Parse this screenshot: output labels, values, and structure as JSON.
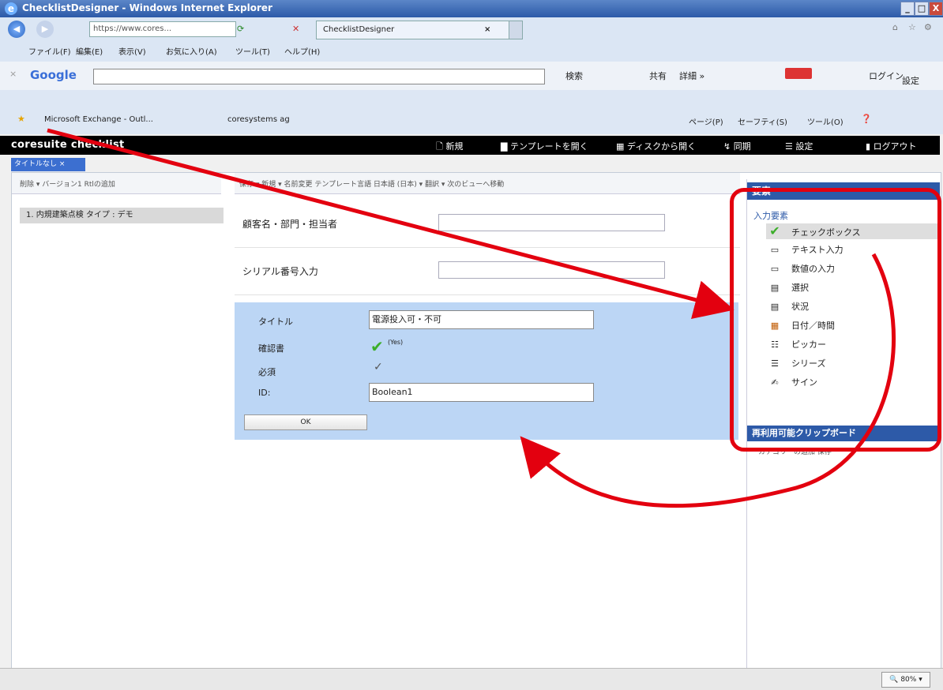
{
  "window": {
    "title": "ChecklistDesigner - Windows Internet Explorer",
    "min": "_",
    "max": "□",
    "close": "X"
  },
  "browser": {
    "url": "https://www.cores...",
    "tab_title": "ChecklistDesigner",
    "tab_close": "×",
    "menu": [
      "ファイル(F)",
      "編集(E)",
      "表示(V)",
      "お気に入り(A)",
      "ツール(T)",
      "ヘルプ(H)"
    ],
    "google_logo": "Google",
    "google_search_btn": "検索",
    "google_share": "共有",
    "google_more": "詳細 »",
    "google_login": "ログイン",
    "google_settings": "設定",
    "favorites": [
      "Microsoft Exchange - Outl...",
      "coresystems ag"
    ],
    "command_bar": [
      "ページ(P)",
      "セーフティ(S)",
      "ツール(O)"
    ]
  },
  "app": {
    "brand": "coresuite checklist",
    "menu": [
      {
        "icon": "new-icon",
        "label": "新規"
      },
      {
        "icon": "folder-icon",
        "label": "テンプレートを開く"
      },
      {
        "icon": "disk-open-icon",
        "label": "ディスクから開く"
      },
      {
        "icon": "sync-icon",
        "label": "同期"
      },
      {
        "icon": "settings-icon",
        "label": "設定"
      },
      {
        "icon": "logout-icon",
        "label": "ログアウト"
      }
    ],
    "doc_tab": "タイトルなし ×"
  },
  "left": {
    "toolbar": "削除 ▾ バージョン1   Rtlの追加",
    "tree_item": "1. 内規建築点検 タイプ : デモ"
  },
  "middle": {
    "toolbar": "保存 ▾ 新規 ▾ 名前変更 テンプレート言語 日本語 (日本)  ▾ 翻訳 ▾ 次のビューへ移動",
    "fields": [
      {
        "label": "顧客名・部門・担当者"
      },
      {
        "label": "シリアル番号入力"
      }
    ],
    "editor": {
      "title_label": "タイトル",
      "title_value": "電源投入可・不可",
      "confirm_label": "確認書",
      "confirm_value": "(Yes)",
      "required_label": "必須",
      "id_label": "ID:",
      "id_value": "Boolean1",
      "ok": "OK"
    }
  },
  "right": {
    "header": "要素",
    "section": "入力要素",
    "items": [
      {
        "icon": "checkmark-icon",
        "label": "チェックボックス"
      },
      {
        "icon": "text-input-icon",
        "label": "テキスト入力"
      },
      {
        "icon": "number-input-icon",
        "label": "数値の入力"
      },
      {
        "icon": "select-icon",
        "label": "選択"
      },
      {
        "icon": "status-icon",
        "label": "状況"
      },
      {
        "icon": "calendar-icon",
        "label": "日付／時間"
      },
      {
        "icon": "picker-icon",
        "label": "ピッカー"
      },
      {
        "icon": "series-icon",
        "label": "シリーズ"
      },
      {
        "icon": "signature-icon",
        "label": "サイン"
      }
    ],
    "clipboard_header": "再利用可能クリップボード",
    "clipboard_toolbar": "カテゴリーの追加   保存"
  },
  "status": {
    "zoom": "80%"
  },
  "colors": {
    "annotation_red": "#e3000f",
    "accent_blue": "#2d5aa8",
    "editor_bg": "#bcd6f5"
  }
}
